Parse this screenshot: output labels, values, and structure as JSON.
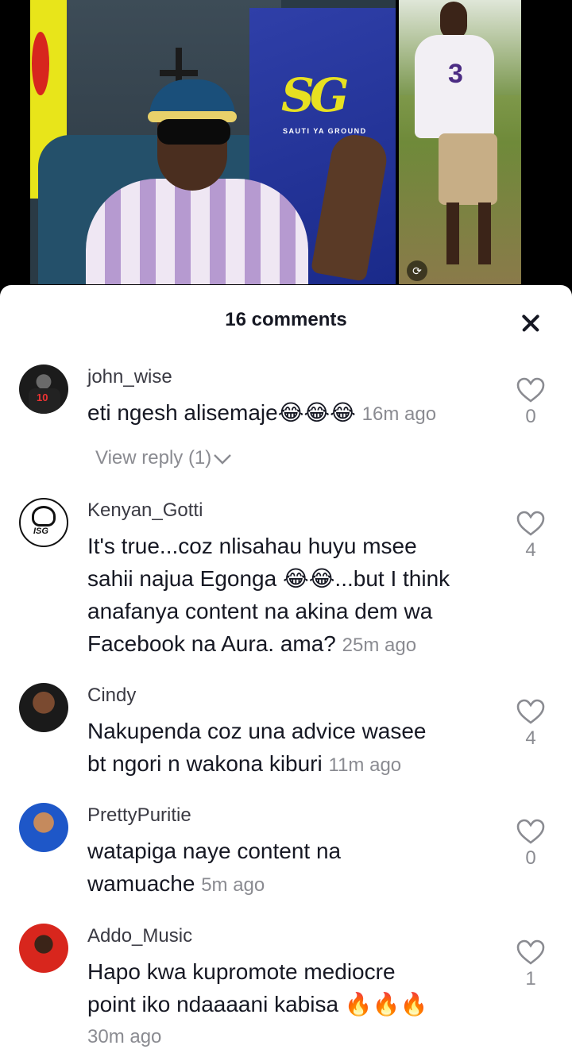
{
  "video": {
    "logo_letters": "SG",
    "logo_caption": "SAUTI YA GROUND",
    "jersey_number": "3"
  },
  "sheet": {
    "title": "16 comments",
    "close_icon": "close-icon"
  },
  "comments": [
    {
      "username": "john_wise",
      "text": "eti ngesh alisemaje",
      "emojis": "😂😂😂",
      "time": "16m ago",
      "likes": "0",
      "view_reply": "View reply (1)"
    },
    {
      "username": "Kenyan_Gotti",
      "text_lines": [
        "It's true...coz nlisahau huyu msee",
        "sahii najua Egonga ",
        "anafanya content na akina dem wa",
        "Facebook na Aura. ama? "
      ],
      "emojis": "😂😂",
      "after_emoji": "...but I think",
      "time": "25m ago",
      "likes": "4"
    },
    {
      "username": "Cindy",
      "text_lines": [
        "Nakupenda coz una advice wasee",
        "bt ngori n wakona kiburi "
      ],
      "time": "11m ago",
      "likes": "4"
    },
    {
      "username": "PrettyPuritie",
      "text_lines": [
        "watapiga naye content na",
        "wamuache "
      ],
      "time": "5m ago",
      "likes": "0"
    },
    {
      "username": "Addo_Music",
      "text_lines": [
        "Hapo kwa kupromote mediocre",
        "point iko ndaaaani kabisa "
      ],
      "emojis": "🔥🔥🔥",
      "time": "30m ago",
      "likes": "1"
    }
  ],
  "kenyan_avatar_text": "ISG"
}
